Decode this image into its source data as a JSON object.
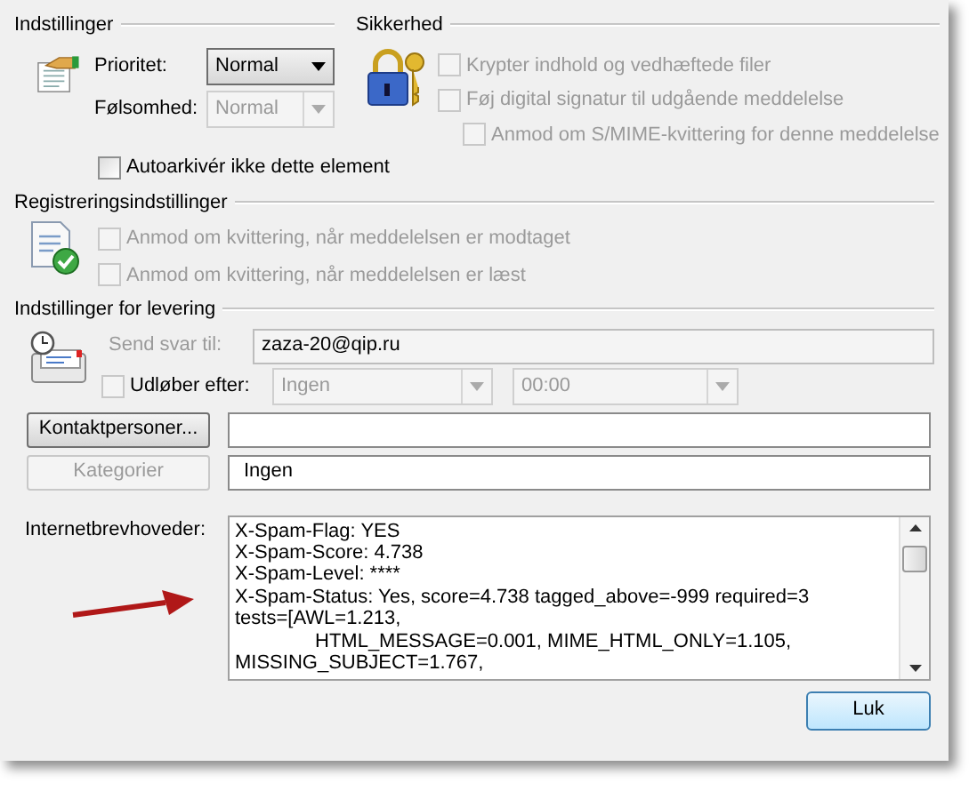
{
  "settings": {
    "title": "Indstillinger",
    "fields": [
      {
        "label": "Prioritet:",
        "value": "Normal",
        "disabled": false
      },
      {
        "label": "Følsomhed:",
        "value": "Normal",
        "disabled": true
      }
    ],
    "autoarchive": {
      "label": "Autoarkivér ikke dette element",
      "checked": false,
      "disabled": false
    }
  },
  "security": {
    "title": "Sikkerhed",
    "options": [
      {
        "label": "Krypter indhold og vedhæftede filer",
        "checked": false,
        "disabled": true,
        "indented": false
      },
      {
        "label": "Føj digital signatur til udgående meddelelse",
        "checked": false,
        "disabled": true,
        "indented": false
      },
      {
        "label": "Anmod om S/MIME-kvittering for denne meddelelse",
        "checked": false,
        "disabled": true,
        "indented": true
      }
    ]
  },
  "tracking": {
    "title": "Registreringsindstillinger",
    "options": [
      {
        "label": "Anmod om kvittering, når meddelelsen er modtaget",
        "checked": false,
        "disabled": true
      },
      {
        "label": "Anmod om kvittering, når meddelelsen er læst",
        "checked": false,
        "disabled": true
      }
    ]
  },
  "delivery": {
    "title": "Indstillinger for levering",
    "reply_to": {
      "label": "Send svar til:",
      "value": "zaza-20@qip.ru",
      "disabled": true
    },
    "expires": {
      "label": "Udløber efter:",
      "checked": false,
      "date": "Ingen",
      "time": "00:00",
      "disabled": true
    }
  },
  "contacts": {
    "button": "Kontaktpersoner...",
    "disabled": false
  },
  "categories": {
    "button": "Kategorier",
    "value": "Ingen",
    "disabled": true
  },
  "headers": {
    "label": "Internetbrevhoveder:",
    "lines": [
      {
        "text": "X-Spam-Flag: YES",
        "indented": false
      },
      {
        "text": "X-Spam-Score: 4.738",
        "indented": false
      },
      {
        "text": "X-Spam-Level: ****",
        "indented": false
      },
      {
        "text": "X-Spam-Status: Yes, score=4.738 tagged_above=-999 required=3",
        "indented": false
      },
      {
        "text": "tests=[AWL=1.213,",
        "indented": false
      },
      {
        "text": "HTML_MESSAGE=0.001, MIME_HTML_ONLY=1.105,",
        "indented": true
      },
      {
        "text": "MISSING_SUBJECT=1.767,",
        "indented": false
      }
    ]
  },
  "close_button": "Luk"
}
